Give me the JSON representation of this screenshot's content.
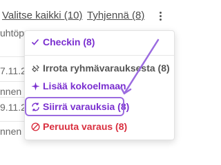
{
  "toolbar": {
    "select_all": "Valitse kaikki (10)",
    "clear": "Tyhjennä (8)",
    "more_icon": "kebab-menu-icon"
  },
  "background": {
    "rows": [
      {
        "text": "uhtöp"
      },
      {
        "text": "7.11.20"
      },
      {
        "text": "nnen"
      },
      {
        "text": "9.11.20"
      },
      {
        "text": "nnen"
      }
    ]
  },
  "menu": {
    "items": [
      {
        "label": "Checkin (8)",
        "icon": "checkmark-icon"
      },
      {
        "label": "Irrota ryhmävarauksesta (8)",
        "icon": "unlink-icon"
      },
      {
        "label": "Lisää kokoelmaan",
        "icon": "sparkle-icon"
      },
      {
        "label": "Siirrä varauksia (8)",
        "icon": "transfer-icon"
      },
      {
        "label": "Peruuta varaus (8)",
        "icon": "cancel-icon"
      }
    ]
  },
  "colors": {
    "accent_violet": "#7a2fcf",
    "danger_red": "#d92f3f",
    "highlight_border": "#9b6be0"
  }
}
